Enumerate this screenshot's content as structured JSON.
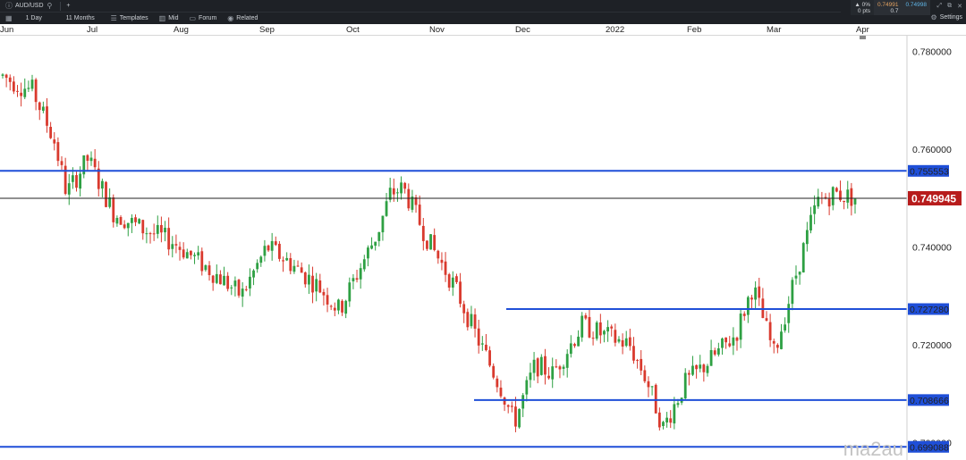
{
  "toolbar": {
    "symbol": "AUD/USD",
    "add": "+",
    "timeframe": "1 Day",
    "range": "11 Months",
    "templates": "Templates",
    "price_type": "Mid",
    "forum": "Forum",
    "related": "Related",
    "settings": "Settings"
  },
  "quote": {
    "change_pct": "0%",
    "change_pts": "0 pts",
    "bid": "0.74991",
    "ask": "0.74998",
    "spread": "0.7"
  },
  "watermark": "ma2au",
  "colors": {
    "up": "#2ea043",
    "down": "#d93a2e",
    "level": "#1f4fd8",
    "current": "#b71c1c"
  },
  "chart_data": {
    "type": "candlestick",
    "x_labels": [
      "Jun",
      "Jul",
      "Aug",
      "Sep",
      "Oct",
      "Nov",
      "Dec",
      "2022",
      "Feb",
      "Mar",
      "Apr"
    ],
    "y_ticks": [
      "0.780000",
      "0.760000",
      "0.740000",
      "0.720000",
      "0.700000"
    ],
    "ylim": [
      0.6964,
      0.7832
    ],
    "current_price": "0.749945",
    "levels": [
      {
        "label": "0.755553",
        "value": 0.75555,
        "x_start": "Jun"
      },
      {
        "label": "0.727280",
        "value": 0.72728,
        "x_start": "Dec"
      },
      {
        "label": "0.708666",
        "value": 0.70867,
        "x_start": "Nov"
      },
      {
        "label": "0.699088",
        "value": 0.69909,
        "x_start": "Jun"
      }
    ],
    "anchors": [
      [
        0.0,
        0.775
      ],
      [
        0.02,
        0.773
      ],
      [
        0.035,
        0.772
      ],
      [
        0.06,
        0.762
      ],
      [
        0.075,
        0.751
      ],
      [
        0.1,
        0.758
      ],
      [
        0.13,
        0.747
      ],
      [
        0.16,
        0.744
      ],
      [
        0.2,
        0.741
      ],
      [
        0.23,
        0.737
      ],
      [
        0.26,
        0.733
      ],
      [
        0.28,
        0.73
      ],
      [
        0.31,
        0.74
      ],
      [
        0.335,
        0.737
      ],
      [
        0.37,
        0.732
      ],
      [
        0.395,
        0.727
      ],
      [
        0.42,
        0.736
      ],
      [
        0.44,
        0.743
      ],
      [
        0.455,
        0.751
      ],
      [
        0.47,
        0.752
      ],
      [
        0.5,
        0.741
      ],
      [
        0.53,
        0.732
      ],
      [
        0.555,
        0.722
      ],
      [
        0.585,
        0.711
      ],
      [
        0.6,
        0.704
      ],
      [
        0.625,
        0.716
      ],
      [
        0.645,
        0.714
      ],
      [
        0.68,
        0.724
      ],
      [
        0.705,
        0.722
      ],
      [
        0.735,
        0.72
      ],
      [
        0.755,
        0.713
      ],
      [
        0.775,
        0.703
      ],
      [
        0.8,
        0.712
      ],
      [
        0.825,
        0.716
      ],
      [
        0.86,
        0.722
      ],
      [
        0.88,
        0.732
      ],
      [
        0.905,
        0.718
      ],
      [
        0.93,
        0.734
      ],
      [
        0.955,
        0.749
      ],
      [
        0.975,
        0.751
      ],
      [
        1.0,
        0.75
      ]
    ]
  }
}
